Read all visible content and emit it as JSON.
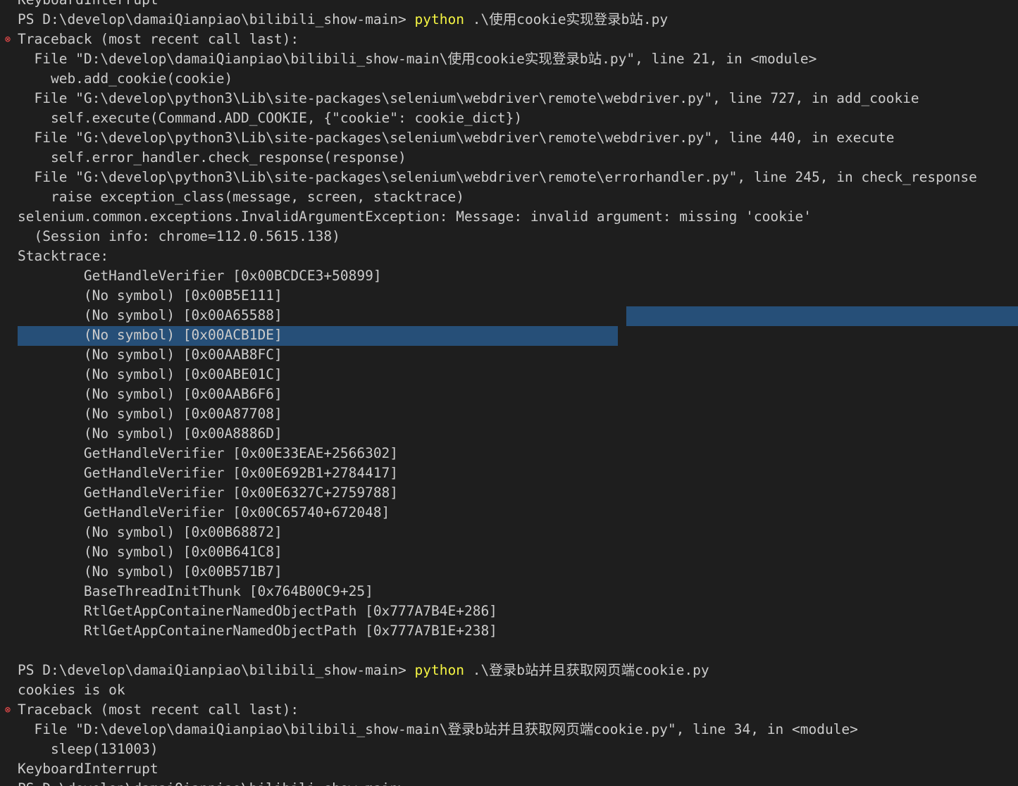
{
  "terminal": {
    "colors": {
      "background": "#1e1e1e",
      "foreground": "#cccccc",
      "command": "#f5f543",
      "error_marker": "#f14c4c",
      "selection": "#264f78"
    },
    "lines": [
      {
        "text": "KeyboardInterrupt"
      },
      {
        "prompt": "PS D:\\develop\\damaiQianpiao\\bilibili_show-main> ",
        "cmd": "python",
        "args": " .\\使用cookie实现登录b站.py"
      },
      {
        "marker": "error-icon",
        "text": "Traceback (most recent call last):"
      },
      {
        "text": "  File \"D:\\develop\\damaiQianpiao\\bilibili_show-main\\使用cookie实现登录b站.py\", line 21, in <module>"
      },
      {
        "text": "    web.add_cookie(cookie)"
      },
      {
        "text": "  File \"G:\\develop\\python3\\Lib\\site-packages\\selenium\\webdriver\\remote\\webdriver.py\", line 727, in add_cookie"
      },
      {
        "text": "    self.execute(Command.ADD_COOKIE, {\"cookie\": cookie_dict})"
      },
      {
        "text": "  File \"G:\\develop\\python3\\Lib\\site-packages\\selenium\\webdriver\\remote\\webdriver.py\", line 440, in execute"
      },
      {
        "text": "    self.error_handler.check_response(response)"
      },
      {
        "text": "  File \"G:\\develop\\python3\\Lib\\site-packages\\selenium\\webdriver\\remote\\errorhandler.py\", line 245, in check_response"
      },
      {
        "text": "    raise exception_class(message, screen, stacktrace)"
      },
      {
        "text": "selenium.common.exceptions.InvalidArgumentException: Message: invalid argument: missing 'cookie'"
      },
      {
        "text": "  (Session info: chrome=112.0.5615.138)"
      },
      {
        "text": "Stacktrace:"
      },
      {
        "text": "        GetHandleVerifier [0x00BCDCE3+50899]"
      },
      {
        "text": "        (No symbol) [0x00B5E111]"
      },
      {
        "text": "        (No symbol) [0x00A65588]"
      },
      {
        "text": "        (No symbol) [0x00ACB1DE]"
      },
      {
        "text": "        (No symbol) [0x00AAB8FC]"
      },
      {
        "text": "        (No symbol) [0x00ABE01C]"
      },
      {
        "text": "        (No symbol) [0x00AAB6F6]"
      },
      {
        "text": "        (No symbol) [0x00A87708]"
      },
      {
        "text": "        (No symbol) [0x00A8886D]"
      },
      {
        "text": "        GetHandleVerifier [0x00E33EAE+2566302]"
      },
      {
        "text": "        GetHandleVerifier [0x00E692B1+2784417]"
      },
      {
        "text": "        GetHandleVerifier [0x00E6327C+2759788]"
      },
      {
        "text": "        GetHandleVerifier [0x00C65740+672048]"
      },
      {
        "text": "        (No symbol) [0x00B68872]"
      },
      {
        "text": "        (No symbol) [0x00B641C8]"
      },
      {
        "text": "        (No symbol) [0x00B571B7]"
      },
      {
        "text": "        BaseThreadInitThunk [0x764B00C9+25]"
      },
      {
        "text": "        RtlGetAppContainerNamedObjectPath [0x777A7B4E+286]"
      },
      {
        "text": "        RtlGetAppContainerNamedObjectPath [0x777A7B1E+238]"
      },
      {
        "text": ""
      },
      {
        "prompt": "PS D:\\develop\\damaiQianpiao\\bilibili_show-main> ",
        "cmd": "python",
        "args": " .\\登录b站并且获取网页端cookie.py"
      },
      {
        "text": "cookies is ok"
      },
      {
        "marker": "error-icon",
        "text": "Traceback (most recent call last):"
      },
      {
        "text": "  File \"D:\\develop\\damaiQianpiao\\bilibili_show-main\\登录b站并且获取网页端cookie.py\", line 34, in <module>"
      },
      {
        "text": "    sleep(131003)"
      },
      {
        "text": "KeyboardInterrupt"
      },
      {
        "text": "PS D:\\develop\\damaiQianpiao\\bilibili_show-main> "
      }
    ]
  }
}
